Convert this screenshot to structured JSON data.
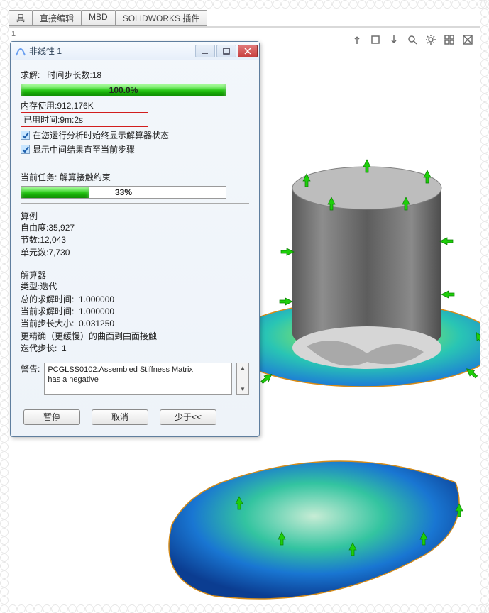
{
  "ribbon": {
    "tabs": [
      "具",
      "直接编辑",
      "MBD",
      "SOLIDWORKS 插件"
    ]
  },
  "viewport": {
    "orientation_label": "1"
  },
  "hud": {
    "icons": [
      "triad-up-icon",
      "ortho-icon",
      "triad-down-icon",
      "search-icon",
      "gear-icon",
      "grid-icon",
      "full-plot-icon"
    ]
  },
  "dialog": {
    "title": "非线性 1",
    "solve_label": "求解:",
    "time_steps_label": "时间步长数:",
    "time_steps_value": "18",
    "progress1_percent": "100.0%",
    "progress1_width": 100,
    "memory_label": "内存使用:",
    "memory_value": "912,176K",
    "elapsed_label": "已用时间:",
    "elapsed_value": "9m:2s",
    "chk1": "在您运行分析时始终显示解算器状态",
    "chk2": "显示中间结果直至当前步骤",
    "task_label": "当前任务:",
    "task_value": "解算接触约束",
    "progress2_percent": "33%",
    "progress2_width": 33,
    "example_title": "算例",
    "dof_label": "自由度:",
    "dof_value": "35,927",
    "nodes_label": "节数:",
    "nodes_value": "12,043",
    "elems_label": "单元数:",
    "elems_value": "7,730",
    "solver_title": "解算器",
    "solver_type_label": "类型:",
    "solver_type_value": "迭代",
    "total_time_label": "总的求解时间:",
    "total_time_value": "1.000000",
    "cur_time_label": "当前求解时间:",
    "cur_time_value": "1.000000",
    "step_size_label": "当前步长大小:",
    "step_size_value": "0.031250",
    "accuracy_line": "更精确（更缓慢）的曲面到曲面接触",
    "iter_step_label": "迭代步长:",
    "iter_step_value": "1",
    "warning_label": "警告:",
    "warning_text_l1": "PCGLSS0102:Assembled Stiffness Matrix",
    "warning_text_l2": "has a negative",
    "btn_pause": "暂停",
    "btn_cancel": "取消",
    "btn_less": "少于<<"
  }
}
